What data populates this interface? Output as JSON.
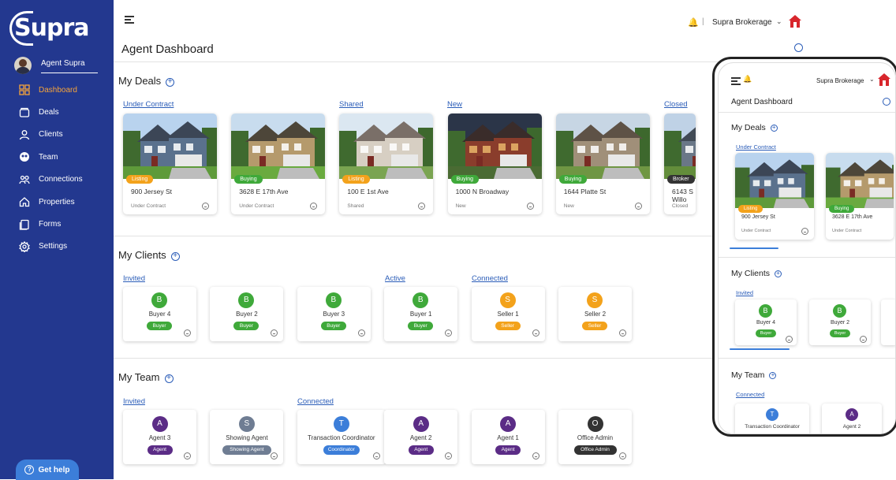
{
  "brand": {
    "logo": "Supra"
  },
  "user": {
    "name": "Agent Supra"
  },
  "nav": [
    {
      "label": "Dashboard",
      "icon": "grid-icon",
      "active": true
    },
    {
      "label": "Deals",
      "icon": "folder-icon"
    },
    {
      "label": "Clients",
      "icon": "person-icon"
    },
    {
      "label": "Team",
      "icon": "team-icon"
    },
    {
      "label": "Connections",
      "icon": "connections-icon"
    },
    {
      "label": "Properties",
      "icon": "home-icon"
    },
    {
      "label": "Forms",
      "icon": "forms-icon"
    },
    {
      "label": "Settings",
      "icon": "gear-icon"
    }
  ],
  "help": {
    "label": "Get help"
  },
  "header": {
    "brokerage": "Supra Brokerage",
    "separator": "|"
  },
  "page": {
    "title": "Agent Dashboard"
  },
  "deals": {
    "title": "My Deals",
    "columns": [
      "Under Contract",
      "Shared",
      "New",
      "Closed"
    ],
    "items": [
      {
        "address": "900 Jersey St",
        "badge": "Listing",
        "status": "Under Contract"
      },
      {
        "address": "3628 E 17th Ave",
        "badge": "Buying",
        "status": "Under Contract"
      },
      {
        "address": "100 E 1st Ave",
        "badge": "Listing",
        "status": "Shared"
      },
      {
        "address": "1000 N Broadway",
        "badge": "Buying",
        "status": "New"
      },
      {
        "address": "1644 Platte St",
        "badge": "Buying",
        "status": "New"
      },
      {
        "address": "6143 S Willo",
        "badge": "Broker",
        "status": "Closed"
      }
    ]
  },
  "clients": {
    "title": "My Clients",
    "columns": [
      "Invited",
      "Active",
      "Connected"
    ],
    "items": [
      {
        "initial": "B",
        "name": "Buyer 4",
        "role": "Buyer"
      },
      {
        "initial": "B",
        "name": "Buyer 2",
        "role": "Buyer"
      },
      {
        "initial": "B",
        "name": "Buyer 3",
        "role": "Buyer"
      },
      {
        "initial": "B",
        "name": "Buyer 1",
        "role": "Buyer"
      },
      {
        "initial": "S",
        "name": "Seller 1",
        "role": "Seller"
      },
      {
        "initial": "S",
        "name": "Seller 2",
        "role": "Seller"
      }
    ]
  },
  "team": {
    "title": "My Team",
    "columns": [
      "Invited",
      "Connected"
    ],
    "items": [
      {
        "initial": "A",
        "name": "Agent 3",
        "role": "Agent"
      },
      {
        "initial": "S",
        "name": "Showing Agent",
        "role": "Showing Agent"
      },
      {
        "initial": "T",
        "name": "Transaction Coordinator",
        "role": "Coordinator"
      },
      {
        "initial": "A",
        "name": "Agent 2",
        "role": "Agent"
      },
      {
        "initial": "A",
        "name": "Agent 1",
        "role": "Agent"
      },
      {
        "initial": "O",
        "name": "Office Admin",
        "role": "Office Admin"
      }
    ]
  },
  "colors": {
    "sidebar": "#23388f",
    "accent": "#f6a43a",
    "link": "#2b5db8",
    "green": "#3fa93a",
    "orange": "#f3a21b",
    "purple": "#5b2c86",
    "slate": "#6f7d93",
    "blue": "#3c7ed9",
    "dark": "#333333"
  }
}
